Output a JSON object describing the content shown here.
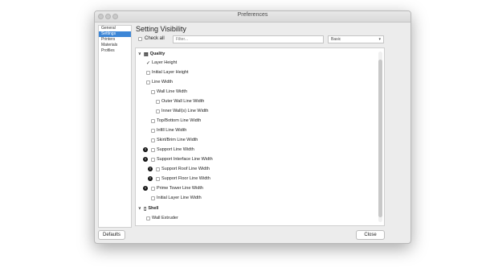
{
  "window": {
    "title": "Preferences"
  },
  "sidebar": {
    "items": [
      {
        "label": "General",
        "selected": false
      },
      {
        "label": "Settings",
        "selected": true
      },
      {
        "label": "Printers",
        "selected": false
      },
      {
        "label": "Materials",
        "selected": false
      },
      {
        "label": "Profiles",
        "selected": false
      }
    ]
  },
  "main": {
    "heading": "Setting Visibility",
    "check_all_label": "Check all",
    "filter_placeholder": "Filter...",
    "preset_value": "Basic"
  },
  "settings_list": {
    "quality_category": "Quality",
    "shell_category": "Shell",
    "quality_items": [
      "Layer Height",
      "Initial Layer Height",
      "Line Width",
      "Wall Line Width",
      "Outer Wall Line Width",
      "Inner Wall(s) Line Width",
      "Top/Bottom Line Width",
      "Infill Line Width",
      "Skirt/Brim Line Width",
      "Support Line Width",
      "Support Interface Line Width",
      "Support Roof Line Width",
      "Support Floor Line Width",
      "Prime Tower Line Width",
      "Initial Layer Line Width"
    ],
    "shell_items": [
      "Wall Extruder"
    ]
  },
  "footer": {
    "defaults_label": "Defaults",
    "close_label": "Close"
  }
}
